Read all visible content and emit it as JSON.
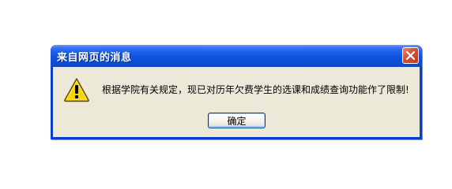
{
  "dialog": {
    "title": "来自网页的消息",
    "message": "根据学院有关规定，现已对历年欠费学生的选课和成绩查询功能作了限制!",
    "ok_label": "确定",
    "icons": {
      "warning": "warning-icon",
      "close": "close-icon"
    }
  },
  "colors": {
    "titlebar": "#0a4ed9",
    "dialog_body": "#ece9d8",
    "close_button": "#d4502e",
    "warning_fill": "#f8d400"
  }
}
